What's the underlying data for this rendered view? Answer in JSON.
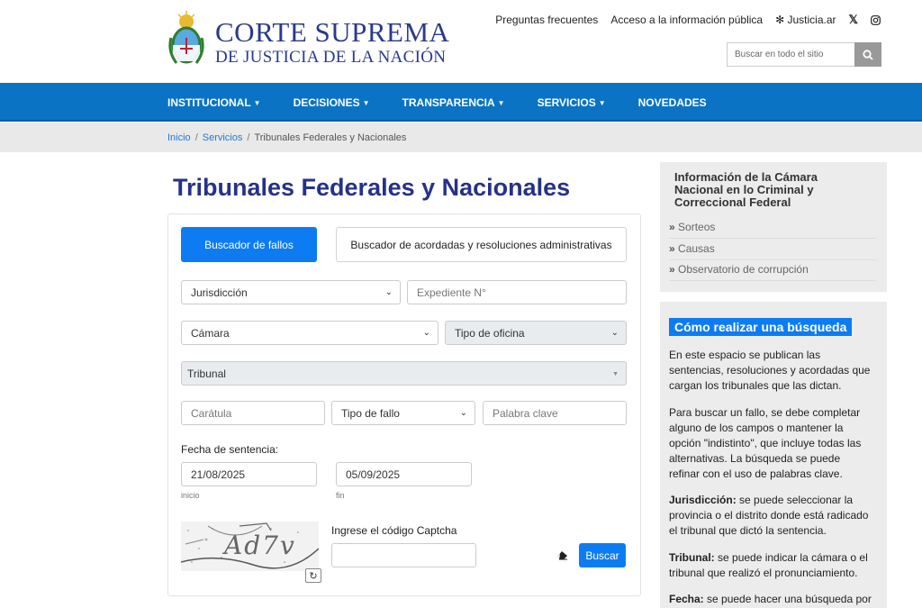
{
  "header": {
    "brand_line1": "CORTE SUPREMA",
    "brand_line2": "DE JUSTICIA DE LA NACIÓN",
    "top_links": [
      "Preguntas frecuentes",
      "Acceso a la información pública",
      "Justicia.ar"
    ],
    "search_placeholder": "Buscar en todo el sitio"
  },
  "nav": {
    "items": [
      "INSTITUCIONAL",
      "DECISIONES",
      "TRANSPARENCIA",
      "SERVICIOS",
      "NOVEDADES"
    ]
  },
  "breadcrumb": {
    "home": "Inicio",
    "section": "Servicios",
    "current": "Tribunales Federales y Nacionales"
  },
  "main": {
    "title": "Tribunales Federales y Nacionales",
    "tab_active": "Buscador de fallos",
    "tab_other": "Buscador de acordadas y resoluciones administrativas",
    "form": {
      "jurisdiccion": "Jurisdicción",
      "expediente_placeholder": "Expediente N°",
      "camara": "Cámara",
      "tipo_oficina": "Tipo de oficina",
      "tribunal": "Tribunal",
      "caratula_placeholder": "Carátula",
      "tipo_fallo": "Tipo de fallo",
      "palabra_placeholder": "Palabra clave",
      "fecha_label": "Fecha de sentencia:",
      "fecha_inicio": "21/08/2025",
      "fecha_fin": "05/09/2025",
      "inicio_label": "inicio",
      "fin_label": "fin",
      "captcha_label": "Ingrese el código Captcha",
      "captcha_text": "Ad7v",
      "buscar": "Buscar"
    }
  },
  "sidebar": {
    "info_title_l1": "Información de la Cámara",
    "info_title_l2": "Nacional en lo Criminal y",
    "info_title_l3": "Correccional Federal",
    "links": [
      "Sorteos",
      "Causas",
      "Observatorio de corrupción"
    ],
    "howto_title": "Cómo realizar una búsqueda",
    "p1": "En este espacio se publican las sentencias, resoluciones y acordadas que cargan los tribunales que las dictan.",
    "p2": "Para buscar un fallo, se debe completar alguno de los campos o mantener la opción \"indistinto\", que incluye todas las alternativas. La búsqueda se puede refinar con el uso de palabras clave.",
    "p3_label": "Jurisdicción:",
    "p3": " se puede seleccionar la provincia o el distrito donde está radicado el tribunal que dictó la sentencia.",
    "p4_label": "Tribunal:",
    "p4": " se puede indicar la cámara o el tribunal que realizó el pronunciamiento.",
    "p5_label": "Fecha:",
    "p5": " se puede hacer una búsqueda por"
  },
  "colors": {
    "nav_blue": "#0a73c4",
    "accent_blue": "#0d7cf2",
    "title_navy": "#25328a"
  }
}
